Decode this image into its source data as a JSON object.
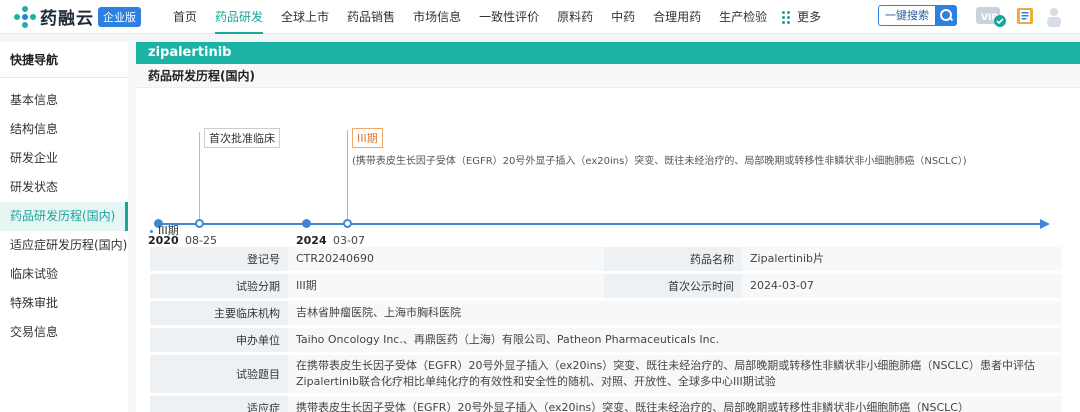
{
  "brand": {
    "name": "药融云",
    "badge": "企业版"
  },
  "nav": {
    "items": [
      "首页",
      "药品研发",
      "全球上市",
      "药品销售",
      "市场信息",
      "一致性评价",
      "原料药",
      "中药",
      "合理用药",
      "生产检验"
    ],
    "active_index": 1,
    "more_label": "更多"
  },
  "search": {
    "button_label": "一键搜索"
  },
  "sidebar": {
    "title": "快捷导航",
    "items": [
      "基本信息",
      "结构信息",
      "研发企业",
      "研发状态",
      "药品研发历程(国内)",
      "适应症研发历程(国内)",
      "临床试验",
      "特殊审批",
      "交易信息"
    ],
    "active_index": 4
  },
  "drug": {
    "name": "zipalertinib"
  },
  "section": {
    "title": "药品研发历程(国内)"
  },
  "timeline": {
    "years": [
      "2020",
      "2024"
    ],
    "events": [
      {
        "date": "08-25",
        "label": "首次批准临床"
      },
      {
        "date": "03-07",
        "label": "III期",
        "note": "(携带表皮生长因子受体（EGFR）20号外显子插入（ex20ins）突变、既往未经治疗的、局部晚期或转移性非鳞状非小细胞肺癌（NSCLC）)"
      }
    ]
  },
  "phase_tag": "III期",
  "details": {
    "reg_no_label": "登记号",
    "reg_no": "CTR20240690",
    "drug_name_label": "药品名称",
    "drug_name": "Zipalertinib片",
    "phase_label": "试验分期",
    "phase": "III期",
    "first_pub_label": "首次公示时间",
    "first_pub": "2024-03-07",
    "sites_label": "主要临床机构",
    "sites": "吉林省肿瘤医院、上海市胸科医院",
    "applicant_label": "申办单位",
    "applicant": "Taiho Oncology Inc.、再鼎医药（上海）有限公司、Patheon Pharmaceuticals Inc.",
    "title_label": "试验题目",
    "title": "在携带表皮生长因子受体（EGFR）20号外显子插入（ex20ins）突变、既往未经治疗的、局部晚期或转移性非鳞状非小细胞肺癌（NSCLC）患者中评估Zipalertinib联合化疗相比单纯化疗的有效性和安全性的随机、对照、开放性、全球多中心III期试验",
    "indication_label": "适应症",
    "indication": "携带表皮生长因子受体（EGFR）20号外显子插入（ex20ins）突变、既往未经治疗的、局部晚期或转移性非鳞状非小细胞肺癌（NSCLC）"
  }
}
